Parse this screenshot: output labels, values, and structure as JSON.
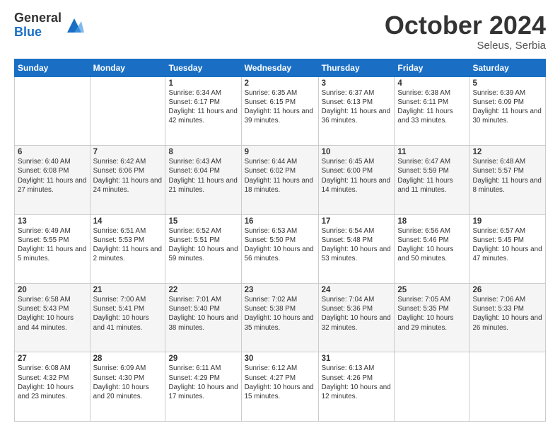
{
  "logo": {
    "general": "General",
    "blue": "Blue"
  },
  "header": {
    "month": "October 2024",
    "location": "Seleus, Serbia"
  },
  "weekdays": [
    "Sunday",
    "Monday",
    "Tuesday",
    "Wednesday",
    "Thursday",
    "Friday",
    "Saturday"
  ],
  "weeks": [
    [
      {
        "day": "",
        "info": ""
      },
      {
        "day": "",
        "info": ""
      },
      {
        "day": "1",
        "info": "Sunrise: 6:34 AM\nSunset: 6:17 PM\nDaylight: 11 hours and 42 minutes."
      },
      {
        "day": "2",
        "info": "Sunrise: 6:35 AM\nSunset: 6:15 PM\nDaylight: 11 hours and 39 minutes."
      },
      {
        "day": "3",
        "info": "Sunrise: 6:37 AM\nSunset: 6:13 PM\nDaylight: 11 hours and 36 minutes."
      },
      {
        "day": "4",
        "info": "Sunrise: 6:38 AM\nSunset: 6:11 PM\nDaylight: 11 hours and 33 minutes."
      },
      {
        "day": "5",
        "info": "Sunrise: 6:39 AM\nSunset: 6:09 PM\nDaylight: 11 hours and 30 minutes."
      }
    ],
    [
      {
        "day": "6",
        "info": "Sunrise: 6:40 AM\nSunset: 6:08 PM\nDaylight: 11 hours and 27 minutes."
      },
      {
        "day": "7",
        "info": "Sunrise: 6:42 AM\nSunset: 6:06 PM\nDaylight: 11 hours and 24 minutes."
      },
      {
        "day": "8",
        "info": "Sunrise: 6:43 AM\nSunset: 6:04 PM\nDaylight: 11 hours and 21 minutes."
      },
      {
        "day": "9",
        "info": "Sunrise: 6:44 AM\nSunset: 6:02 PM\nDaylight: 11 hours and 18 minutes."
      },
      {
        "day": "10",
        "info": "Sunrise: 6:45 AM\nSunset: 6:00 PM\nDaylight: 11 hours and 14 minutes."
      },
      {
        "day": "11",
        "info": "Sunrise: 6:47 AM\nSunset: 5:59 PM\nDaylight: 11 hours and 11 minutes."
      },
      {
        "day": "12",
        "info": "Sunrise: 6:48 AM\nSunset: 5:57 PM\nDaylight: 11 hours and 8 minutes."
      }
    ],
    [
      {
        "day": "13",
        "info": "Sunrise: 6:49 AM\nSunset: 5:55 PM\nDaylight: 11 hours and 5 minutes."
      },
      {
        "day": "14",
        "info": "Sunrise: 6:51 AM\nSunset: 5:53 PM\nDaylight: 11 hours and 2 minutes."
      },
      {
        "day": "15",
        "info": "Sunrise: 6:52 AM\nSunset: 5:51 PM\nDaylight: 10 hours and 59 minutes."
      },
      {
        "day": "16",
        "info": "Sunrise: 6:53 AM\nSunset: 5:50 PM\nDaylight: 10 hours and 56 minutes."
      },
      {
        "day": "17",
        "info": "Sunrise: 6:54 AM\nSunset: 5:48 PM\nDaylight: 10 hours and 53 minutes."
      },
      {
        "day": "18",
        "info": "Sunrise: 6:56 AM\nSunset: 5:46 PM\nDaylight: 10 hours and 50 minutes."
      },
      {
        "day": "19",
        "info": "Sunrise: 6:57 AM\nSunset: 5:45 PM\nDaylight: 10 hours and 47 minutes."
      }
    ],
    [
      {
        "day": "20",
        "info": "Sunrise: 6:58 AM\nSunset: 5:43 PM\nDaylight: 10 hours and 44 minutes."
      },
      {
        "day": "21",
        "info": "Sunrise: 7:00 AM\nSunset: 5:41 PM\nDaylight: 10 hours and 41 minutes."
      },
      {
        "day": "22",
        "info": "Sunrise: 7:01 AM\nSunset: 5:40 PM\nDaylight: 10 hours and 38 minutes."
      },
      {
        "day": "23",
        "info": "Sunrise: 7:02 AM\nSunset: 5:38 PM\nDaylight: 10 hours and 35 minutes."
      },
      {
        "day": "24",
        "info": "Sunrise: 7:04 AM\nSunset: 5:36 PM\nDaylight: 10 hours and 32 minutes."
      },
      {
        "day": "25",
        "info": "Sunrise: 7:05 AM\nSunset: 5:35 PM\nDaylight: 10 hours and 29 minutes."
      },
      {
        "day": "26",
        "info": "Sunrise: 7:06 AM\nSunset: 5:33 PM\nDaylight: 10 hours and 26 minutes."
      }
    ],
    [
      {
        "day": "27",
        "info": "Sunrise: 6:08 AM\nSunset: 4:32 PM\nDaylight: 10 hours and 23 minutes."
      },
      {
        "day": "28",
        "info": "Sunrise: 6:09 AM\nSunset: 4:30 PM\nDaylight: 10 hours and 20 minutes."
      },
      {
        "day": "29",
        "info": "Sunrise: 6:11 AM\nSunset: 4:29 PM\nDaylight: 10 hours and 17 minutes."
      },
      {
        "day": "30",
        "info": "Sunrise: 6:12 AM\nSunset: 4:27 PM\nDaylight: 10 hours and 15 minutes."
      },
      {
        "day": "31",
        "info": "Sunrise: 6:13 AM\nSunset: 4:26 PM\nDaylight: 10 hours and 12 minutes."
      },
      {
        "day": "",
        "info": ""
      },
      {
        "day": "",
        "info": ""
      }
    ]
  ]
}
